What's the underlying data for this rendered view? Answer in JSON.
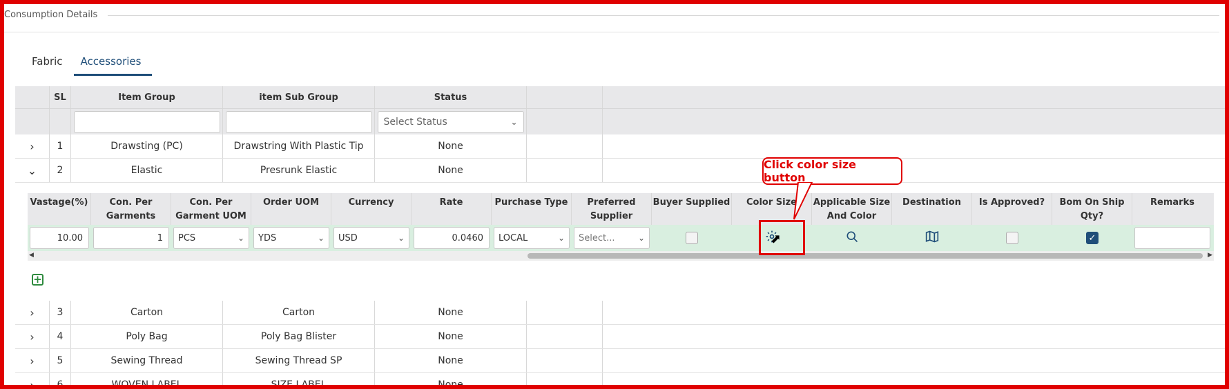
{
  "section": {
    "title": "Consumption Details"
  },
  "tabs": [
    {
      "label": "Fabric",
      "active": false
    },
    {
      "label": "Accessories",
      "active": true
    }
  ],
  "table": {
    "headers": {
      "sl": "SL",
      "item_group": "Item Group",
      "item_sub_group": "item Sub Group",
      "status": "Status"
    },
    "filters": {
      "status_placeholder": "Select Status"
    },
    "rows": [
      {
        "sl": "1",
        "item_group": "Drawsting (PC)",
        "item_sub_group": "Drawstring With Plastic Tip",
        "status": "None",
        "expanded": false
      },
      {
        "sl": "2",
        "item_group": "Elastic",
        "item_sub_group": "Presrunk Elastic",
        "status": "None",
        "expanded": true
      },
      {
        "sl": "3",
        "item_group": "Carton",
        "item_sub_group": "Carton",
        "status": "None",
        "expanded": false
      },
      {
        "sl": "4",
        "item_group": "Poly Bag",
        "item_sub_group": "Poly Bag Blister",
        "status": "None",
        "expanded": false
      },
      {
        "sl": "5",
        "item_group": "Sewing Thread",
        "item_sub_group": "Sewing Thread SP",
        "status": "None",
        "expanded": false
      },
      {
        "sl": "6",
        "item_group": "WOVEN LABEL",
        "item_sub_group": "SIZE LABEL",
        "status": "None",
        "expanded": false
      }
    ]
  },
  "subtable": {
    "headers": {
      "wastage": "Vastage(%)",
      "con_per_garments_1": "Con. Per",
      "con_per_garments_2": "Garments",
      "con_uom_1": "Con. Per",
      "con_uom_2": "Garment UOM",
      "order_uom": "Order UOM",
      "currency": "Currency",
      "rate": "Rate",
      "purchase_type": "Purchase Type",
      "pref_supplier_1": "Preferred",
      "pref_supplier_2": "Supplier",
      "buyer_supplied": "Buyer Supplied",
      "color_size": "Color Size",
      "applicable_1": "Applicable Size",
      "applicable_2": "And Color",
      "destination": "Destination",
      "is_approved": "Is Approved?",
      "bom_1": "Bom On Ship",
      "bom_2": "Qty?",
      "remarks": "Remarks"
    },
    "row": {
      "wastage": "10.00",
      "con_per_garments": "1",
      "con_uom": "PCS",
      "order_uom": "YDS",
      "currency": "USD",
      "rate": "0.0460",
      "purchase_type": "LOCAL",
      "preferred_supplier_placeholder": "Select...",
      "buyer_supplied": false,
      "is_approved": false,
      "bom_on_ship_qty": true
    }
  },
  "annotation": {
    "callout_text": "Click color size button"
  },
  "colors": {
    "accent": "#1f4e79",
    "highlight": "#e00000",
    "row_green": "#d9efe0"
  },
  "icons": {
    "expand": "chevron-right-icon",
    "collapse": "chevron-down-icon",
    "color_size": "gear-icon",
    "applicable": "search-icon",
    "destination": "map-icon",
    "add": "plus-square-icon"
  }
}
